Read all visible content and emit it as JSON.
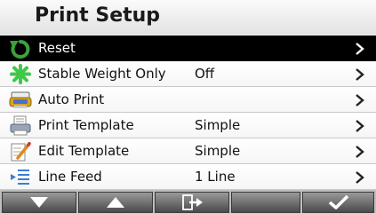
{
  "title": "Print Setup",
  "menu": [
    {
      "label": "Reset",
      "value": "",
      "icon": "reset-arrow-icon",
      "selected": true
    },
    {
      "label": "Stable Weight Only",
      "value": "Off",
      "icon": "stable-weight-icon",
      "selected": false
    },
    {
      "label": "Auto Print",
      "value": "",
      "icon": "auto-print-icon",
      "selected": false
    },
    {
      "label": "Print Template",
      "value": "Simple",
      "icon": "print-template-icon",
      "selected": false
    },
    {
      "label": "Edit Template",
      "value": "Simple",
      "icon": "edit-template-icon",
      "selected": false
    },
    {
      "label": "Line Feed",
      "value": "1 Line",
      "icon": "line-feed-icon",
      "selected": false
    }
  ],
  "softkeys": [
    {
      "icon": "arrow-down-icon"
    },
    {
      "icon": "arrow-up-icon"
    },
    {
      "icon": "exit-icon"
    },
    {
      "icon": "blank"
    },
    {
      "icon": "checkmark-icon"
    }
  ],
  "colors": {
    "selected_row": "#000000",
    "reset_icon": "#3aa33a",
    "stable_icon": "#3fc84a",
    "chevron": "#222222"
  }
}
